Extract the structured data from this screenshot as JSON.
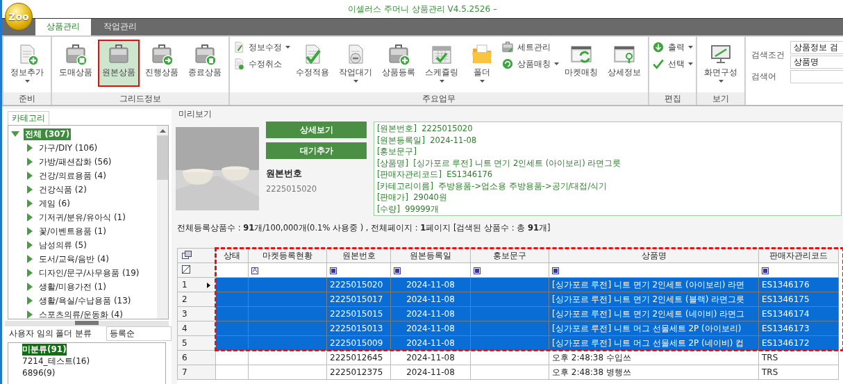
{
  "window": {
    "logo": "Zoo",
    "title": "이셀러스 주머니 상품관리 V4.5.2526 –"
  },
  "tabs": [
    {
      "label": "상품관리",
      "selected": true
    },
    {
      "label": "작업관리",
      "selected": false
    }
  ],
  "ribbon": [
    {
      "label": "준비",
      "items": [
        {
          "kind": "large",
          "label": "정보추가",
          "dropdown": true
        }
      ]
    },
    {
      "label": "그리드정보",
      "items": [
        {
          "kind": "large",
          "label": "도매상품",
          "selected": false
        },
        {
          "kind": "large",
          "label": "원본상품",
          "selected": true
        },
        {
          "kind": "large",
          "label": "진행상품",
          "selected": false
        },
        {
          "kind": "large",
          "label": "종료상품",
          "selected": false
        }
      ]
    },
    {
      "label": "주요업무",
      "items": [
        {
          "kind": "stack",
          "items": [
            {
              "label": "정보수정",
              "dropdown": true
            },
            {
              "label": "수정취소"
            }
          ]
        },
        {
          "kind": "large",
          "label": "수정적용"
        },
        {
          "kind": "large",
          "label": "작업대기",
          "dropdown": true
        },
        {
          "kind": "large",
          "label": "상품등록"
        },
        {
          "kind": "large",
          "label": "스케쥴링",
          "dropdown": true
        },
        {
          "kind": "large",
          "label": "폴더",
          "dropdown": true
        },
        {
          "kind": "stack",
          "items": [
            {
              "label": "세트관리"
            },
            {
              "label": "상품매칭",
              "dropdown": true
            }
          ]
        },
        {
          "kind": "large",
          "label": "마켓매칭"
        },
        {
          "kind": "large",
          "label": "상세정보"
        }
      ]
    },
    {
      "label": "편집",
      "items": [
        {
          "kind": "stack",
          "items": [
            {
              "label": "출력",
              "dropdown": true
            },
            {
              "label": "선택",
              "dropdown": true
            }
          ]
        }
      ]
    },
    {
      "label": "보기",
      "items": [
        {
          "kind": "large",
          "label": "화면구성",
          "dropdown": true
        }
      ]
    }
  ],
  "search": {
    "condition_label": "검색조건",
    "condition_values": [
      "상품정보 검",
      "상품명"
    ],
    "keyword_label": "검색어"
  },
  "category": {
    "tab": "카테고리",
    "tree": [
      {
        "label": "전체 (307)",
        "expanded": true,
        "selected": true,
        "children": [
          {
            "label": "가구/DIY (106)",
            "expanded": false,
            "selected": false
          },
          {
            "label": "가방/패션잡화 (56)",
            "expanded": false,
            "selected": false
          },
          {
            "label": "건강/의료용품 (4)",
            "expanded": false,
            "selected": false
          },
          {
            "label": "건강식품 (2)",
            "expanded": false,
            "selected": false
          },
          {
            "label": "게임 (6)",
            "expanded": false,
            "selected": false
          },
          {
            "label": "기저귀/분유/유아식 (1)",
            "expanded": false,
            "selected": false
          },
          {
            "label": "꽃/이벤트용품 (1)",
            "expanded": false,
            "selected": false
          },
          {
            "label": "남성의류 (5)",
            "expanded": false,
            "selected": false
          },
          {
            "label": "도서/교육/음반  (4)",
            "expanded": false,
            "selected": false
          },
          {
            "label": "디자인/문구/사무용품 (19)",
            "expanded": false,
            "selected": false
          },
          {
            "label": "생활/미용가전 (1)",
            "expanded": false,
            "selected": false
          },
          {
            "label": "생활/욕실/수납용품 (13)",
            "expanded": false,
            "selected": false
          },
          {
            "label": "스포츠의류/운동화 (4)",
            "expanded": false,
            "selected": false
          }
        ]
      }
    ]
  },
  "folders": {
    "title": "사용자 임의 폴더 분류",
    "sort": "등록순",
    "items": [
      {
        "label": "미분류(91)",
        "selected": true
      },
      {
        "label": "7214_테스트(16)",
        "selected": false
      },
      {
        "label": "6896(9)",
        "selected": false
      }
    ]
  },
  "preview": {
    "title": "미리보기",
    "buttons": [
      "상세보기",
      "대기추가"
    ],
    "number_label": "원본번호",
    "number": "2225015020",
    "details": [
      {
        "key": "[원본번호]",
        "value": "2225015020"
      },
      {
        "key": "[원본등록일]",
        "value": "2024-11-08"
      },
      {
        "key": "[홍보문구]"
      },
      {
        "key": "[상품명]",
        "value": "[싱가포르 루전] 니트 면기 2인세트 (아이보리) 라면그릇"
      },
      {
        "key": "[판매자관리코드]",
        "value": "ES1346176"
      },
      {
        "key": "[카테고리이름]",
        "value": "주방용품->업소용 주방용품->공기/대접/식기"
      },
      {
        "key": "[판매가]",
        "value": "29040원"
      },
      {
        "key": "[수량]",
        "value": "99999개"
      }
    ]
  },
  "summary": "전체등록상품수 : **91**개/100,000개(0.1% 사용중 ) , 전체페이지 : **1**페이지  [검색된 상품수 : 총 **91**개]",
  "grid": {
    "columns": [
      {
        "label": "상태",
        "filter": {
          "kind": "none"
        }
      },
      {
        "label": "마켓등록현황",
        "filter": {
          "kind": "letter",
          "text": "A"
        }
      },
      {
        "label": "원본번호",
        "filter": {
          "kind": "box"
        }
      },
      {
        "label": "원본등록일",
        "filter": {
          "kind": "box"
        }
      },
      {
        "label": "홍보문구",
        "filter": {
          "kind": "box"
        }
      },
      {
        "label": "상품명",
        "filter": {
          "kind": "box"
        }
      },
      {
        "label": "판매자관리코드",
        "filter": {
          "kind": "box"
        }
      }
    ],
    "rows": [
      {
        "number": "1",
        "selected": true,
        "current": true,
        "cells": [
          null,
          null,
          "2225015020",
          "2024-11-08",
          null,
          "[싱가포르 루전] 니트 면기 2인세트 (아이보리) 라면",
          "ES1346176"
        ]
      },
      {
        "number": "2",
        "selected": true,
        "current": false,
        "cells": [
          null,
          null,
          "2225015017",
          "2024-11-08",
          null,
          "[싱가포르 루전] 니트 면기 2인세트 (블랙) 라면그릇",
          "ES1346175"
        ]
      },
      {
        "number": "3",
        "selected": true,
        "current": false,
        "cells": [
          null,
          null,
          "2225015015",
          "2024-11-08",
          null,
          "[싱가포르 루전] 니트 면기 2인세트 (네이비) 라면그",
          "ES1346174"
        ]
      },
      {
        "number": "4",
        "selected": true,
        "current": false,
        "cells": [
          null,
          null,
          "2225015013",
          "2024-11-08",
          null,
          "[싱가포르 루전] 니트 머그 선물세트 2P (아이보리)",
          "ES1346173"
        ]
      },
      {
        "number": "5",
        "selected": true,
        "current": false,
        "cells": [
          null,
          null,
          "2225015009",
          "2024-11-08",
          null,
          "[싱가포르 루전] 니트 머그 선물세트 2P (네이비) 컵",
          "ES1346172"
        ]
      },
      {
        "number": "6",
        "selected": false,
        "current": false,
        "cells": [
          null,
          null,
          "2225012645",
          "2024-11-08",
          null,
          "오후 2:48:38 수입쓰",
          "TRS"
        ]
      },
      {
        "number": "7",
        "selected": false,
        "current": false,
        "cells": [
          null,
          null,
          "2225012375",
          "2024-11-08",
          null,
          "오후 2:48:38 병행쓰",
          "TRS"
        ]
      }
    ]
  }
}
